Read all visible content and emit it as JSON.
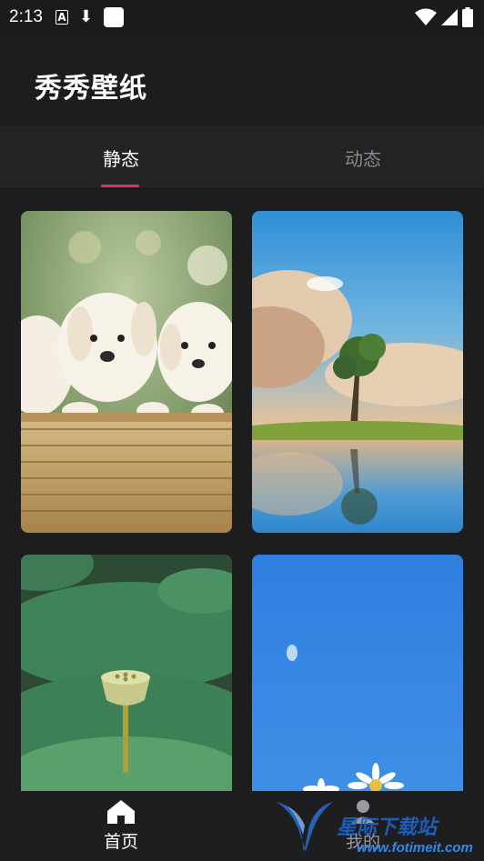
{
  "status_bar": {
    "time": "2:13",
    "icons": [
      "font-a-icon",
      "download-icon",
      "app-square-icon",
      "wifi-icon",
      "signal-icon",
      "battery-icon"
    ]
  },
  "app_bar": {
    "title": "秀秀壁纸"
  },
  "tabs": [
    {
      "label": "静态",
      "selected": true
    },
    {
      "label": "动态",
      "selected": false
    }
  ],
  "accent_color": "#e0305e",
  "wallpapers": [
    {
      "subject": "puppies in wicker basket"
    },
    {
      "subject": "lone tree on island reflected in water"
    },
    {
      "subject": "lotus seed pod among green leaves"
    },
    {
      "subject": "daisies under blue sky"
    }
  ],
  "bottom_nav": [
    {
      "label": "首页",
      "icon": "home-icon",
      "selected": true
    },
    {
      "label": "我的",
      "icon": "person-icon",
      "selected": false
    }
  ],
  "watermark": {
    "text": "星际下载站",
    "url": "www.fotimeit.com"
  }
}
